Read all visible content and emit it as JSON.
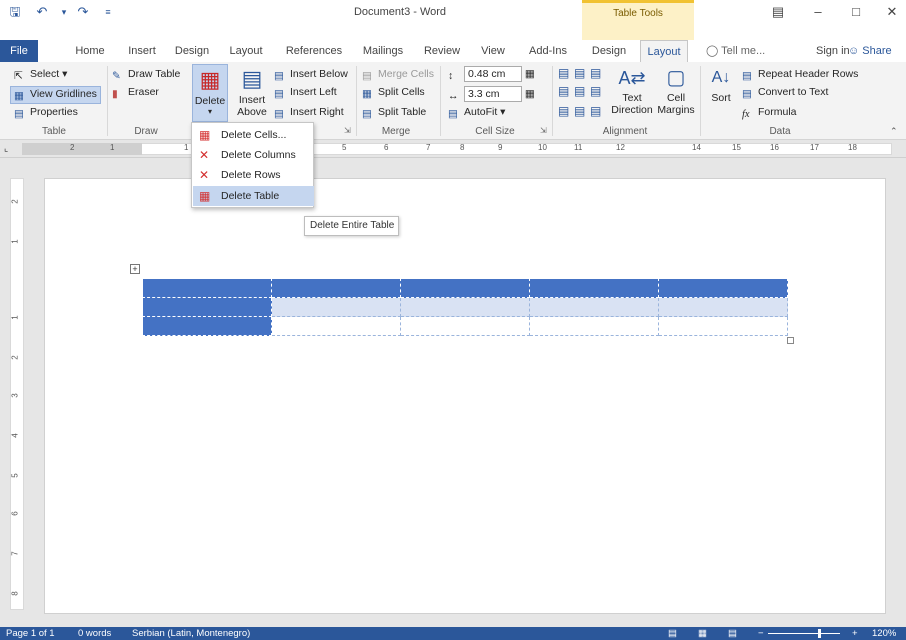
{
  "window": {
    "title": "Document3 - Word",
    "context_tab_group": "Table Tools"
  },
  "tabs": [
    "File",
    "Home",
    "Insert",
    "Design",
    "Layout",
    "References",
    "Mailings",
    "Review",
    "View",
    "Add-Ins",
    "Design",
    "Layout"
  ],
  "tell_me": "Tell me...",
  "sign_in": "Sign in",
  "share": "Share",
  "ribbon": {
    "table": {
      "select": "Select",
      "view_gridlines": "View Gridlines",
      "properties": "Properties",
      "label": "Table"
    },
    "draw": {
      "draw_table": "Draw Table",
      "eraser": "Eraser",
      "label": "Draw"
    },
    "rows_cols": {
      "delete": "Delete",
      "insert_above_1": "Insert",
      "insert_above_2": "Above",
      "insert_below": "Insert Below",
      "insert_left": "Insert Left",
      "insert_right": "Insert Right"
    },
    "merge": {
      "merge_cells": "Merge Cells",
      "split_cells": "Split Cells",
      "split_table": "Split Table",
      "label": "Merge"
    },
    "cell_size": {
      "height": "0.48 cm",
      "width": "3.3 cm",
      "autofit": "AutoFit",
      "label": "Cell Size"
    },
    "alignment": {
      "text_direction_1": "Text",
      "text_direction_2": "Direction",
      "cell_margins_1": "Cell",
      "cell_margins_2": "Margins",
      "label": "Alignment"
    },
    "data": {
      "sort": "Sort",
      "repeat_header_rows": "Repeat Header Rows",
      "convert_to_text": "Convert to Text",
      "formula": "Formula",
      "label": "Data"
    }
  },
  "delete_menu": [
    "Delete Cells...",
    "Delete Columns",
    "Delete Rows",
    "Delete Table"
  ],
  "tooltip": "Delete Entire Table",
  "ruler_numbers": [
    "2",
    "1",
    "1",
    "5",
    "6",
    "7",
    "8",
    "9",
    "10",
    "11",
    "12",
    "14",
    "15",
    "16",
    "17",
    "18"
  ],
  "vruler_numbers": [
    "2",
    "1",
    "1",
    "2",
    "3",
    "4",
    "5",
    "6",
    "7",
    "8"
  ],
  "status": {
    "page": "Page 1 of 1",
    "words": "0 words",
    "language": "Serbian (Latin, Montenegro)",
    "zoom": "120%"
  },
  "colors": {
    "accent": "#2b579a",
    "table_header": "#4472c4",
    "table_band": "#d9e2f3"
  }
}
